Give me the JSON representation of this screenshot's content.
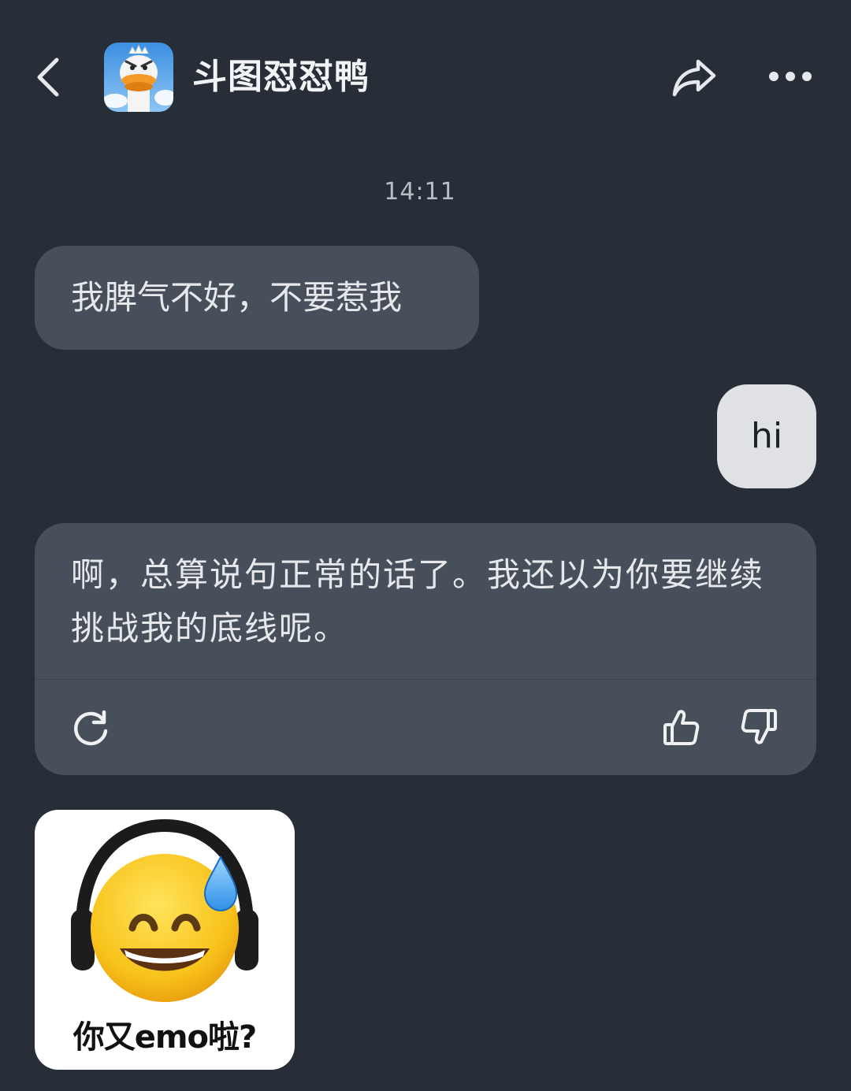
{
  "header": {
    "title": "斗图怼怼鸭",
    "back_icon": "chevron-left-icon",
    "share_icon": "share-arrow-icon",
    "more_icon": "more-dots-icon",
    "avatar": "duck-avatar"
  },
  "chat": {
    "timestamp": "14:11",
    "messages": [
      {
        "role": "bot",
        "text": "我脾气不好，不要惹我"
      },
      {
        "role": "user",
        "text": "hi"
      },
      {
        "role": "bot",
        "text": "啊，总算说句正常的话了。我还以为你要继续挑战我的底线呢。"
      }
    ],
    "actions": {
      "regenerate_icon": "refresh-icon",
      "like_icon": "thumbs-up-icon",
      "dislike_icon": "thumbs-down-icon"
    },
    "sticker": {
      "caption": "你又emo啦?",
      "emoji": "grinning-face-with-sweat-headphones"
    }
  },
  "colors": {
    "background": "#272e38",
    "bot_bubble": "#474f5a",
    "user_bubble": "#dfe1e5"
  }
}
